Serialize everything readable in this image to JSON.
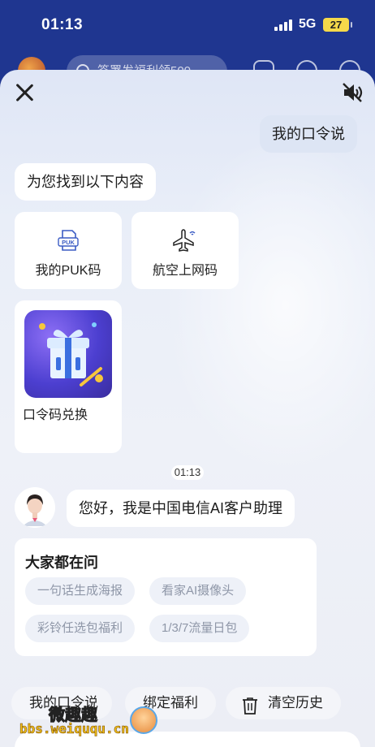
{
  "status_bar": {
    "time": "01:13",
    "network": "5G",
    "battery": "27"
  },
  "background_app": {
    "search_placeholder": "签署发福利领500"
  },
  "chat": {
    "user_message": "我的口令说",
    "bot_intro": "为您找到以下内容",
    "result_cards": [
      {
        "label": "我的PUK码",
        "icon": "puk-icon"
      },
      {
        "label": "航空上网码",
        "icon": "airplane-wifi-icon"
      },
      {
        "label": "口令码兑换",
        "icon": "gift-box-image"
      }
    ],
    "timestamp": "01:13",
    "bot_greeting": "您好，我是中国电信AI客户助理"
  },
  "faq": {
    "title": "大家都在问",
    "chips": [
      "一句话生成海报",
      "看家AI摄像头",
      "彩铃任选包福利",
      "1/3/7流量日包"
    ]
  },
  "bottom_actions": {
    "my_command": "我的口令说",
    "bind_benefits": "绑定福利",
    "clear_history": "清空历史"
  },
  "watermark": {
    "text_cn": "微趣趣",
    "text_url": "bbs.weiququ.cn"
  },
  "colors": {
    "status_bg": "#1f3690",
    "battery": "#f5d94a",
    "chip_bg": "#eef1f8",
    "gift_purple": "#4c3fd0"
  }
}
